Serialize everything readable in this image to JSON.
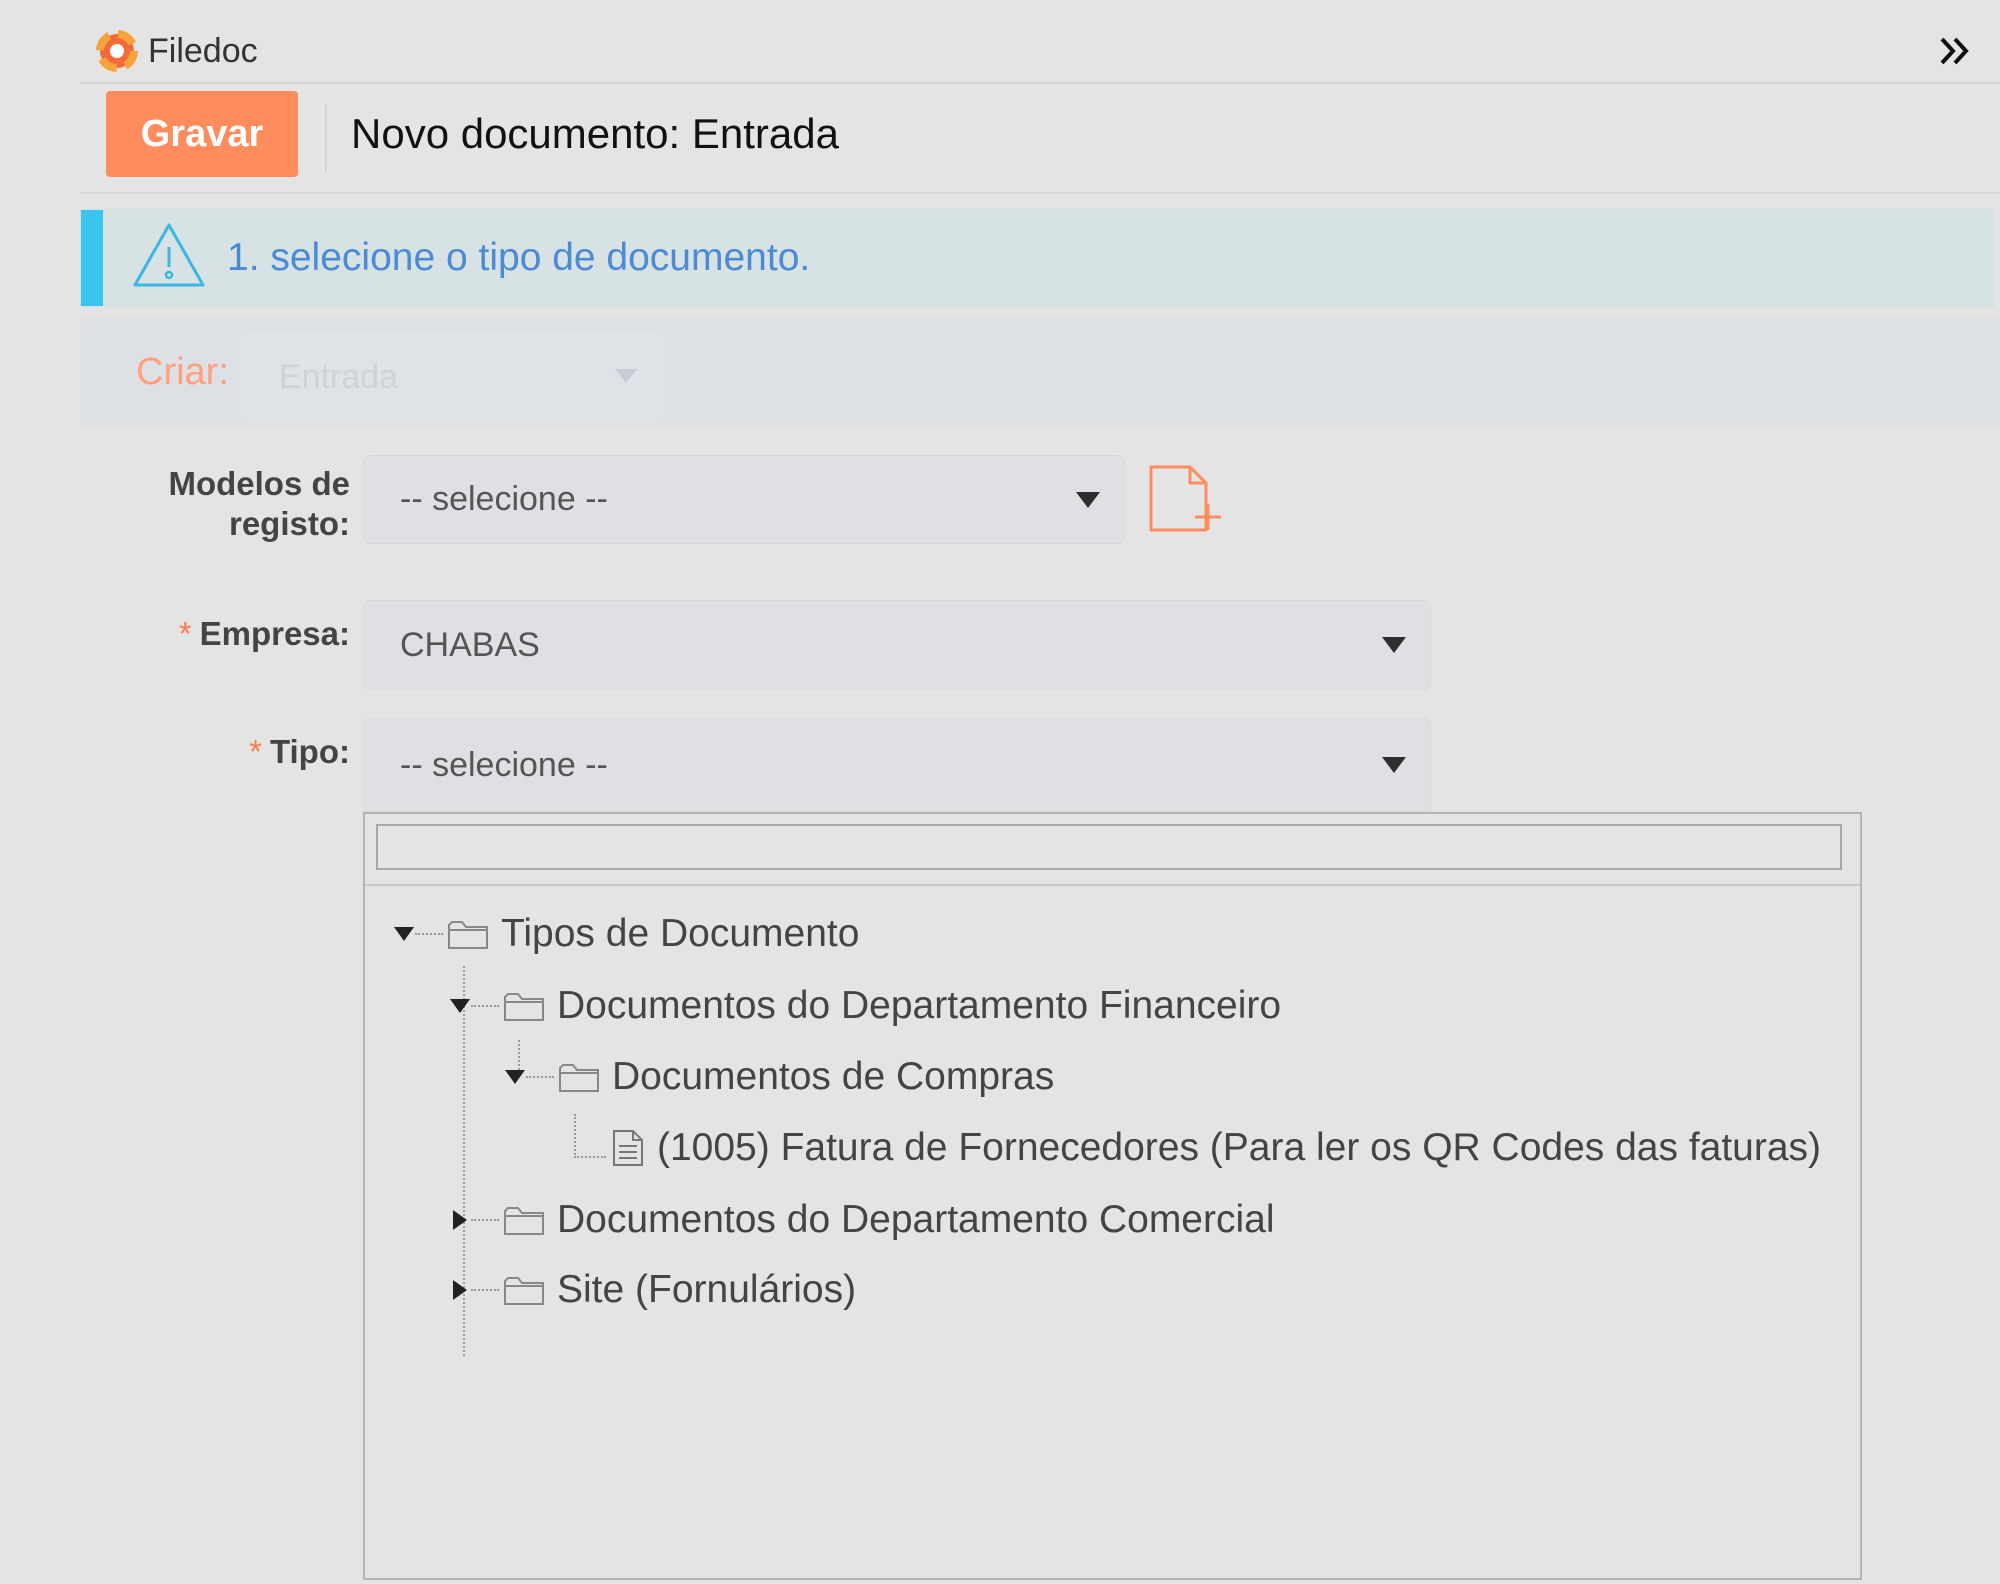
{
  "app": {
    "name": "Filedoc",
    "logo_icon": "filedoc-logo-icon",
    "expand_icon": "double-chevron-right-icon"
  },
  "toolbar": {
    "save_label": "Gravar",
    "page_title": "Novo documento: Entrada"
  },
  "alert": {
    "icon": "warning-triangle-icon",
    "text": "1. selecione o tipo de documento."
  },
  "criar": {
    "label": "Criar:",
    "value": "Entrada"
  },
  "form": {
    "modelos": {
      "label_line1": "Modelos de",
      "label_line2": "registo:",
      "value": "-- selecione --"
    },
    "empresa": {
      "required_mark": "*",
      "label": "Empresa:",
      "value": "CHABAS"
    },
    "tipo": {
      "required_mark": "*",
      "label": "Tipo:",
      "value": "-- selecione --"
    },
    "add_template_icon": "add-document-icon"
  },
  "tree": {
    "search_value": "",
    "items": [
      {
        "label": "Tipos de Documento",
        "level": 0,
        "kind": "folder",
        "state": "expanded"
      },
      {
        "label": "Documentos do Departamento Financeiro",
        "level": 1,
        "kind": "folder",
        "state": "expanded"
      },
      {
        "label": "Documentos de Compras",
        "level": 2,
        "kind": "folder",
        "state": "expanded"
      },
      {
        "label": "(1005) Fatura de Fornecedores (Para ler os QR Codes das faturas)",
        "level": 3,
        "kind": "document",
        "state": "leaf"
      },
      {
        "label": "Documentos do Departamento Comercial",
        "level": 1,
        "kind": "folder",
        "state": "collapsed"
      },
      {
        "label": "Site (Fornulários)",
        "level": 1,
        "kind": "folder",
        "state": "collapsed"
      }
    ]
  },
  "colors": {
    "accent_orange": "#ff8c5c",
    "alert_bar": "#3bc4ef",
    "alert_text": "#4c8ad4",
    "required": "#ff7b4c"
  }
}
